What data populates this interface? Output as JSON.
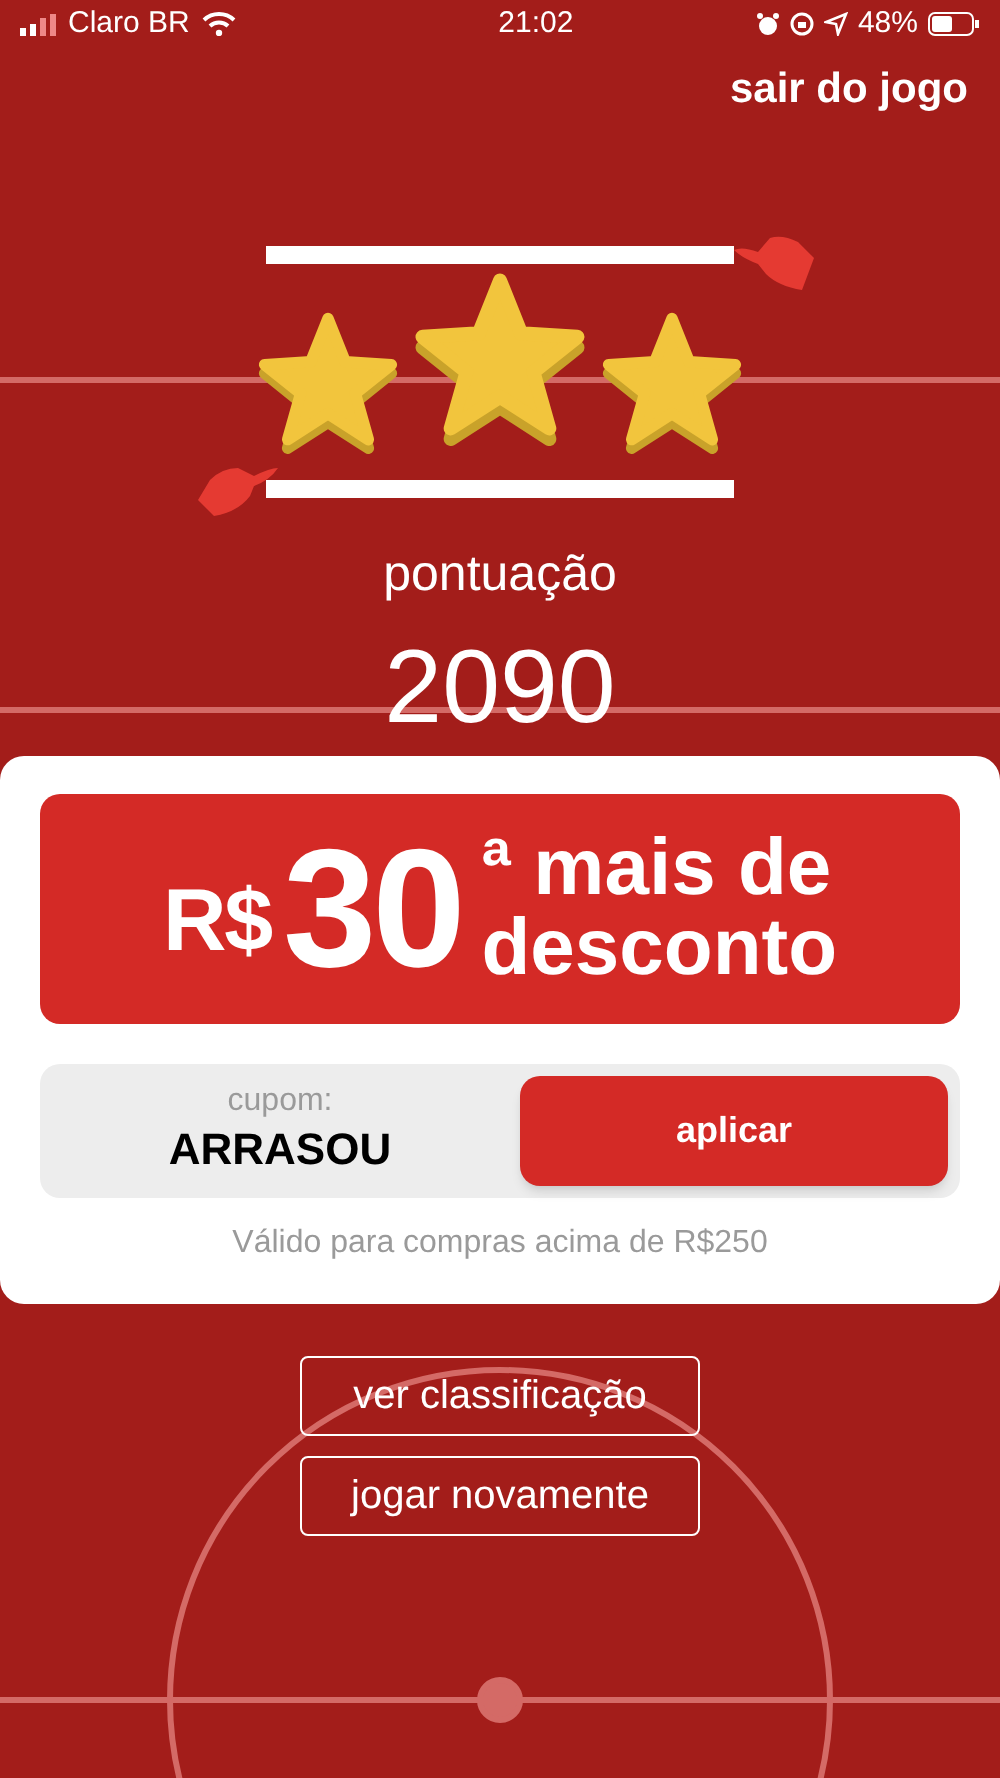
{
  "status_bar": {
    "carrier": "Claro BR",
    "time": "21:02",
    "battery": "48%"
  },
  "exit_link": "sair do jogo",
  "result": {
    "stars": 3,
    "score_label": "pontuação",
    "score": "2090"
  },
  "offer": {
    "currency": "R$",
    "amount": "30",
    "line_1": "ª mais de",
    "line_2": "desconto"
  },
  "coupon": {
    "label": "cupom:",
    "code": "ARRASOU",
    "button": "aplicar"
  },
  "terms": "Válido para compras acima de R$250",
  "buttons": [
    "ver classificação",
    "jogar novamente"
  ]
}
